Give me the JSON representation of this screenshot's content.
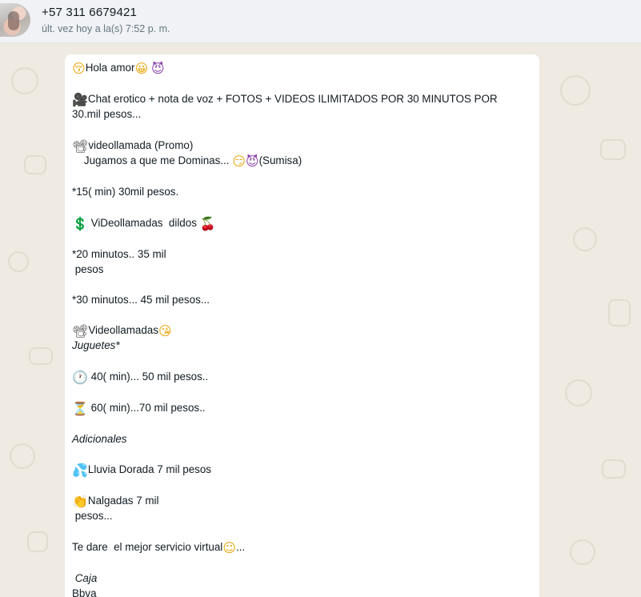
{
  "header": {
    "contact_name": "+57 311 6679421",
    "last_seen": "últ. vez hoy a la(s) 7:52 p. m."
  },
  "icons": {
    "kiss_face": "😚",
    "grin_face": "😀",
    "devil_face": "😈",
    "movie_camera": "🎥",
    "projector": "📽",
    "smirk_face": "😏",
    "dollar_sign": "💲",
    "cherries": "🍒",
    "blowing_kiss": "😘",
    "clock": "🕐",
    "hourglass": "⏳",
    "sweat_drops": "💦",
    "clapping_hands": "👏",
    "smiling_face": "☺"
  },
  "message": {
    "greeting": "Hola amor",
    "chat_offer_line1": "Chat erotico + nota de voz + FOTOS + VIDEOS ILIMITADOS POR 30 MINUTOS POR",
    "chat_offer_line2": "30.mil pesos...",
    "videocall_promo": "videollamada (Promo)",
    "dominas": "    Jugamos a que me Dominas... ",
    "sumisa": "(Sumisa)",
    "promo_price": "*15( min) 30mil pesos.",
    "dildos_title": " ViDeollamadas  dildos ",
    "dildos_price_20a": "*20 minutos.. 35 mil",
    "dildos_price_20b": " pesos",
    "dildos_price_30": "*30 minutos... 45 mil pesos...",
    "videollamadas": "Videollamadas",
    "juguetes": "Juguetes*",
    "toys_40": " 40( min)... 50 mil pesos..",
    "toys_60": " 60( min)...70 mil pesos..",
    "adicionales": "Adicionales",
    "lluvia": "Lluvia Dorada 7 mil pesos",
    "nalgadas_a": "Nalgadas 7 mil",
    "nalgadas_b": " pesos...",
    "closing": "Te dare  el mejor servicio virtual",
    "closing_dots": "...",
    "caja": " Caja",
    "bbva": "Bbva"
  }
}
